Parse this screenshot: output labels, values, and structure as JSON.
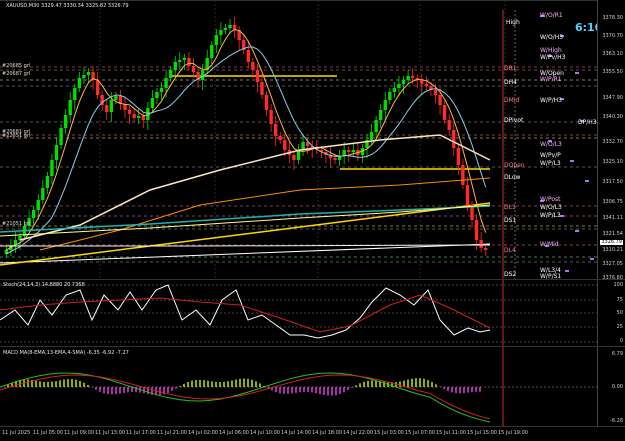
{
  "header": {
    "symbol_line": "XAUUSD,M30  3329.47 3330.34 3325.82 3326.79"
  },
  "countdown": "6:10",
  "stochastic": {
    "title": "Stoch(24,14,3) 14.8880 20.7368",
    "levels": [
      "100",
      "75",
      "50",
      "25",
      "0"
    ]
  },
  "macd": {
    "title": "MACD MA(8-EMA,13-EMA,4-SMA) -6.35 -6.92 -7.27",
    "levels": [
      "6.79",
      "0.00",
      "-6.28"
    ]
  },
  "price_axis": [
    "3378.30",
    "3370.70",
    "3363.10",
    "3355.50",
    "3347.90",
    "3340.30",
    "3332.70",
    "3325.10",
    "3317.50",
    "3306.75",
    "3341.11",
    "3321.54",
    "3310.21",
    "3327.05",
    "3376.80"
  ],
  "current_price": "3326.79",
  "time_labels": [
    "11 Jul 2025",
    "11 Jul 05:00",
    "11 Jul 09:00",
    "11 Jul 13:00",
    "11 Jul 17:00",
    "11 Jul 21:00",
    "14 Jul 02:00",
    "14 Jul 06:00",
    "14 Jul 10:00",
    "14 Jul 14:00",
    "14 Jul 18:00",
    "14 Jul 22:00",
    "15 Jul 03:00",
    "15 Jul 07:00",
    "15 Jul 11:00",
    "15 Jul 15:00",
    "15 Jul 19:00"
  ],
  "level_labels": {
    "right": [
      "W/O/R1",
      "High",
      "W/O/H3",
      "W/High",
      "W/Pv/H3",
      "W/Open",
      "W/P/R1",
      "W/P/H3",
      "DP/H3",
      "W/O/L3",
      "W/Pv/P",
      "W/P/L3",
      "W/Post",
      "W/O/L3",
      "W/P/L3",
      "W/Mid",
      "W/L3/4",
      "W/P/S1"
    ],
    "left": [
      "DR1",
      "DH4",
      "DMid",
      "DPivot",
      "DOpen",
      "DLow",
      "DL3",
      "DS1",
      "DL4",
      "DS2"
    ],
    "price_tags": [
      "#20685 grl",
      "#20687 grl",
      "#20681 grl",
      "#22051 grl",
      "#21051 grl"
    ]
  }
}
